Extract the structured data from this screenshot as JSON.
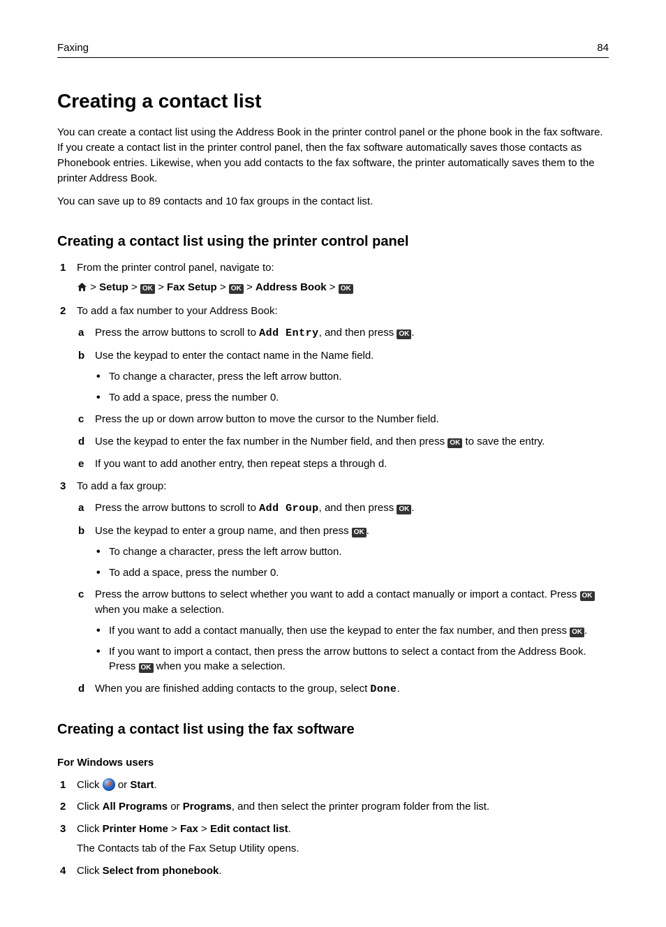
{
  "header": {
    "section": "Faxing",
    "page_number": "84"
  },
  "title": "Creating a contact list",
  "intro": [
    "You can create a contact list using the Address Book in the printer control panel or the phone book in the fax software. If you create a contact list in the printer control panel, then the fax software automatically saves those contacts as Phonebook entries. Likewise, when you add contacts to the fax software, the printer automatically saves them to the printer Address Book.",
    "You can save up to 89 contacts and 10 fax groups in the contact list."
  ],
  "section_a": {
    "heading": "Creating a contact list using the printer control panel",
    "step1_lead": "From the printer control panel, navigate to:",
    "nav": {
      "setup": "Setup",
      "fax_setup": "Fax Setup",
      "address_book": "Address Book"
    },
    "step2_lead": "To add a fax number to your Address Book:",
    "s2a_pre": "Press the arrow buttons to scroll to ",
    "s2a_mono": "Add Entry",
    "s2a_post": ", and then press ",
    "s2b": "Use the keypad to enter the contact name in the Name field.",
    "s2b_b1": "To change a character, press the left arrow button.",
    "s2b_b2": "To add a space, press the number 0.",
    "s2c": "Press the up or down arrow button to move the cursor to the Number field.",
    "s2d_pre": "Use the keypad to enter the fax number in the Number field, and then press ",
    "s2d_post": " to save the entry.",
    "s2e": "If you want to add another entry, then repeat steps a through d.",
    "step3_lead": "To add a fax group:",
    "s3a_pre": "Press the arrow buttons to scroll to ",
    "s3a_mono": "Add Group",
    "s3a_post": ", and then press ",
    "s3b_pre": "Use the keypad to enter a group name, and then press ",
    "s3b_b1": "To change a character, press the left arrow button.",
    "s3b_b2": "To add a space, press the number 0.",
    "s3c_pre": "Press the arrow buttons to select whether you want to add a contact manually or import a contact. Press ",
    "s3c_post": " when you make a selection.",
    "s3c_b1_pre": "If you want to add a contact manually, then use the keypad to enter the fax number, and then press ",
    "s3c_b2_pre": "If you want to import a contact, then press the arrow buttons to select a contact from the Address Book. Press ",
    "s3c_b2_post": " when you make a selection.",
    "s3d_pre": "When you are finished adding contacts to the group, select ",
    "s3d_mono": "Done"
  },
  "section_b": {
    "heading": "Creating a contact list using the fax software",
    "win_heading": "For Windows users",
    "w1_pre": "Click ",
    "w1_or": " or ",
    "w1_start": "Start",
    "w2_pre": "Click ",
    "w2_b1": "All Programs",
    "w2_or": " or ",
    "w2_b2": "Programs",
    "w2_post": ", and then select the printer program folder from the list.",
    "w3_pre": "Click ",
    "w3_b1": "Printer Home",
    "w3_b2": "Fax",
    "w3_b3": "Edit contact list",
    "w3_sub": "The Contacts tab of the Fax Setup Utility opens.",
    "w4_pre": "Click ",
    "w4_b": "Select from phonebook"
  },
  "glyphs": {
    "ok": "OK",
    "gt": ">"
  }
}
